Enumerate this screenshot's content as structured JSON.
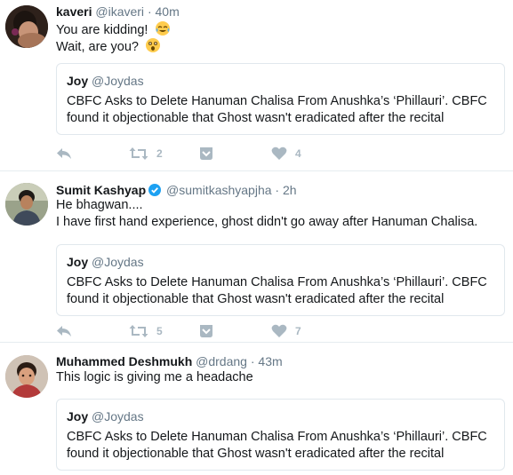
{
  "quoted_tweet": {
    "name": "Joy",
    "handle": "@Joydas",
    "text": "CBFC Asks to Delete Hanuman Chalisa From Anushka’s ‘Phillauri’. CBFC found it objectionable that Ghost wasn't eradicated after the recital"
  },
  "tweets": [
    {
      "name": "kaveri",
      "handle": "@ikaveri",
      "separator": "·",
      "time": "40m",
      "lines": [
        "You are kidding!",
        "Wait, are you?"
      ],
      "line_emojis": [
        "tears-of-joy-emoji",
        "astonished-face-emoji"
      ],
      "retweets": "2",
      "likes": "4"
    },
    {
      "name": "Sumit Kashyap",
      "handle": "@sumitkashyapjha",
      "separator": "·",
      "time": "2h",
      "verified": true,
      "lines": [
        "He bhagwan....",
        "I have first hand experience, ghost didn't go away after Hanuman Chalisa."
      ],
      "retweets": "5",
      "likes": "7"
    },
    {
      "name": "Muhammed Deshmukh",
      "handle": "@drdang",
      "separator": "·",
      "time": "43m",
      "lines": [
        "This logic is giving me a headache"
      ]
    }
  ],
  "icons": [
    "reply-icon",
    "retweet-icon",
    "save-icon",
    "heart-icon",
    "verified-badge-icon"
  ],
  "colors": {
    "text": "#14171a",
    "muted": "#657786",
    "action_icons": "#aab8c2",
    "verified": "#1da1f2",
    "border": "#e1e8ed"
  }
}
